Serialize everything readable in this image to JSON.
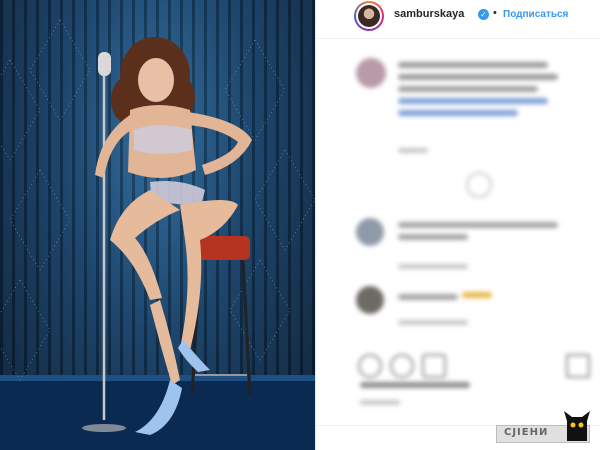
{
  "post": {
    "username": "samburskaya",
    "verified_icon": "verified-badge-icon",
    "separator": "•",
    "follow_label": "Подписаться"
  },
  "photo": {
    "alt": "photo",
    "colors": {
      "curtain": "#163f66",
      "stage": "#0b2a52",
      "chair": "#b5341f"
    }
  },
  "colors": {
    "accent": "#3897f0",
    "text": "#262626",
    "muted": "#c7c7c7"
  },
  "watermark": {
    "label": "CJIEHИ"
  }
}
